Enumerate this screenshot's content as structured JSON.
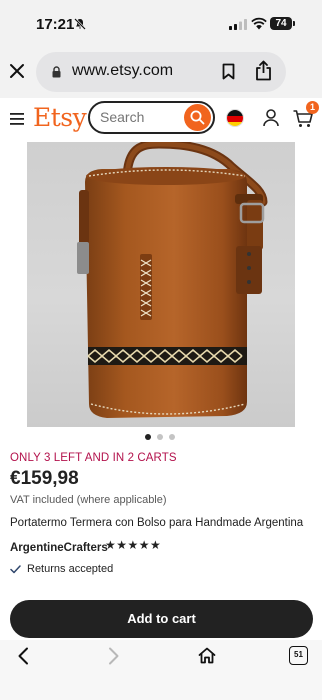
{
  "status_bar": {
    "time": "17:21",
    "battery": "74"
  },
  "browser": {
    "url": "www.etsy.com"
  },
  "header": {
    "logo": "Etsy",
    "search_placeholder": "Search",
    "cart_count": "1"
  },
  "product": {
    "image_dots_count": 3,
    "active_dot_index": 0,
    "stock_alert": "ONLY 3 LEFT AND IN 2 CARTS",
    "price": "€159,98",
    "vat_note": "VAT included (where applicable)",
    "title": "Portatermo Termera con Bolso para Handmade Argentina",
    "shop_name": "ArgentineCrafters",
    "rating_stars": "★★★★★",
    "returns": "Returns accepted",
    "add_to_cart_label": "Add to cart"
  },
  "toolbar": {
    "tabs_count": "51"
  },
  "colors": {
    "brand": "#f1641e",
    "stock_alert": "#b3124c",
    "button_dark": "#222222"
  }
}
